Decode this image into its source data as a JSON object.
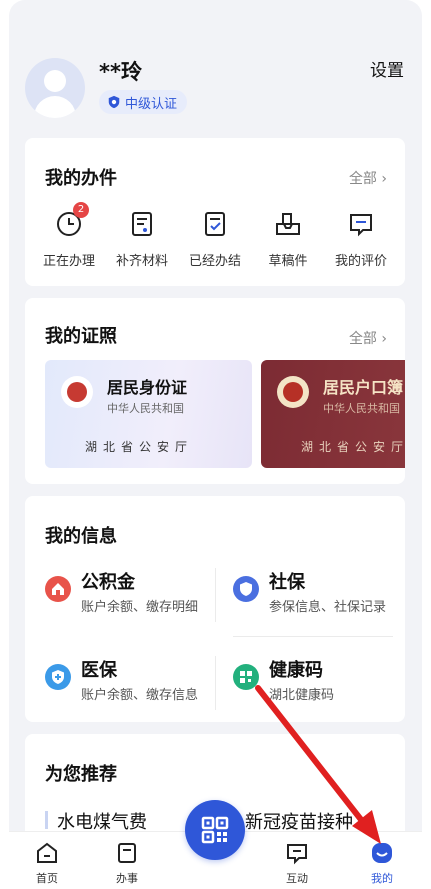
{
  "header": {
    "username": "**玲",
    "certification": "中级认证",
    "settings_label": "设置"
  },
  "tasks": {
    "title": "我的办件",
    "more": "全部",
    "items": [
      {
        "label": "正在办理",
        "icon": "clock-icon",
        "badge": "2"
      },
      {
        "label": "补齐材料",
        "icon": "document-add-icon"
      },
      {
        "label": "已经办结",
        "icon": "document-check-icon"
      },
      {
        "label": "草稿件",
        "icon": "draft-tray-icon"
      },
      {
        "label": "我的评价",
        "icon": "comment-icon"
      }
    ]
  },
  "licenses": {
    "title": "我的证照",
    "more": "全部",
    "cards": [
      {
        "name": "居民身份证",
        "sub": "中华人民共和国",
        "issuer": "湖北省公安厅"
      },
      {
        "name": "居民户口簿",
        "sub": "中华人民共和国",
        "issuer": "湖北省公安厅"
      }
    ]
  },
  "info": {
    "title": "我的信息",
    "items": [
      {
        "name": "公积金",
        "desc": "账户余额、缴存明细",
        "icon": "house-fund-icon",
        "color": "#e8534a"
      },
      {
        "name": "社保",
        "desc": "参保信息、社保记录",
        "icon": "social-security-icon",
        "color": "#4a6fe0"
      },
      {
        "name": "医保",
        "desc": "账户余额、缴存信息",
        "icon": "medical-insurance-icon",
        "color": "#3b9ae8"
      },
      {
        "name": "健康码",
        "desc": "湖北健康码",
        "icon": "health-code-icon",
        "color": "#22b07d"
      }
    ]
  },
  "recommend": {
    "title": "为您推荐",
    "items": [
      "水电煤气费",
      "新冠疫苗接种"
    ]
  },
  "nav": {
    "items": [
      {
        "label": "首页",
        "icon": "home-icon"
      },
      {
        "label": "办事",
        "icon": "tasks-icon"
      },
      {
        "label": "互动",
        "icon": "chat-icon"
      },
      {
        "label": "我的",
        "icon": "profile-icon",
        "active": true
      }
    ],
    "scan_icon": "qr-scan-icon"
  },
  "colors": {
    "accent": "#2f57d8",
    "badge": "#e54545",
    "annotation_arrow": "#e02020"
  }
}
